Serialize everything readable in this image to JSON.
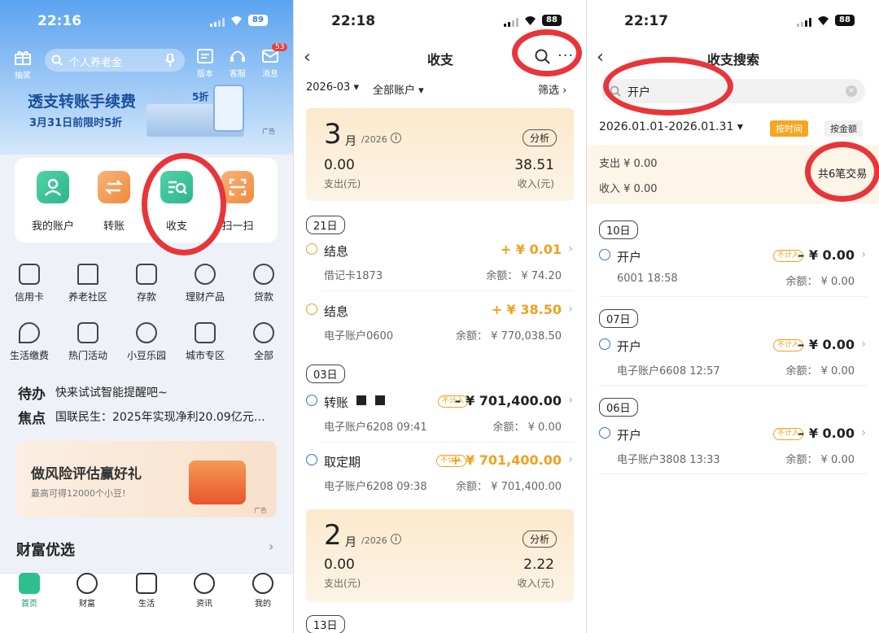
{
  "p1": {
    "time": "22:16",
    "battery": "89",
    "search_placeholder": "个人养老金",
    "top_icons": [
      "抽奖",
      "版本",
      "客服",
      "消息"
    ],
    "msg_badge": "53",
    "banner_title": "透支转账手续费",
    "banner_sub": "3月31日前限时5折",
    "banner_tag": "5折",
    "ad": "广告",
    "quick": [
      "我的账户",
      "转账",
      "收支",
      "扫一扫"
    ],
    "grid": [
      "信用卡",
      "养老社区",
      "存款",
      "理财产品",
      "贷款",
      "生活缴费",
      "热门活动",
      "小豆乐园",
      "城市专区",
      "全部"
    ],
    "todo_label": "待办",
    "todo_text": "快来试试智能提醒吧~",
    "focus_label": "焦点",
    "focus_text": "国联民生：2025年实现净利20.09亿元…",
    "promo_title": "做风险评估赢好礼",
    "promo_sub": "最高可得12000个小豆!",
    "wealth_title": "财富优选",
    "tabs": [
      "首页",
      "财富",
      "生活",
      "资讯",
      "我的"
    ],
    "colors": {
      "accent": "#1e6fd9",
      "green": "#2fbf8f",
      "orange": "#f5a04a"
    }
  },
  "p2": {
    "time": "22:18",
    "battery": "88",
    "title": "收支",
    "month_filter": "2026-03",
    "account_filter": "全部账户",
    "screen": "筛选",
    "cards": [
      {
        "month": "3",
        "unit": "月",
        "year": "/2026",
        "analyze": "分析",
        "expense": "0.00",
        "expense_label": "支出(元)",
        "income": "38.51",
        "income_label": "收入(元)"
      },
      {
        "month": "2",
        "unit": "月",
        "year": "/2026",
        "analyze": "分析",
        "expense": "0.00",
        "expense_label": "支出(元)",
        "income": "2.22",
        "income_label": "收入(元)"
      }
    ],
    "days": [
      "21日",
      "03日",
      "13日"
    ],
    "tx": [
      {
        "name": "结息",
        "amount": "+ ¥ 0.01",
        "acct": "借记卡1873",
        "bal": "余额： ¥  74.20"
      },
      {
        "name": "结息",
        "amount": "+ ¥ 38.50",
        "acct": "电子账户0600",
        "bal": "余额： ¥  770,038.50"
      },
      {
        "name": "转账",
        "tag": "不计入",
        "amount": "– ¥ 701,400.00",
        "acct": "电子账户6208 09:41",
        "bal": "余额： ¥  0.00"
      },
      {
        "name": "取定期",
        "tag": "不计入",
        "amount": "+ ¥ 701,400.00",
        "acct": "电子账户6208 09:38",
        "bal": "余额： ¥  701,400.00"
      }
    ]
  },
  "p3": {
    "time": "22:17",
    "battery": "88",
    "title": "收支搜索",
    "search_value": "开户",
    "date_range": "2026.01.01-2026.01.31",
    "sort_time": "按时间",
    "sort_amount": "按金额",
    "expense": "支出 ¥ 0.00",
    "income": "收入 ¥ 0.00",
    "count": "共6笔交易",
    "days": [
      "10日",
      "07日",
      "06日"
    ],
    "tx": [
      {
        "name": "开户",
        "tag": "不计入",
        "amount": "– ¥ 0.00",
        "acct": "6001 18:58",
        "bal": "余额： ¥  0.00"
      },
      {
        "name": "开户",
        "tag": "不计入",
        "amount": "– ¥ 0.00",
        "acct": "电子账户6608 12:57",
        "bal": "余额： ¥  0.00"
      },
      {
        "name": "开户",
        "tag": "不计入",
        "amount": "– ¥ 0.00",
        "acct": "电子账户3808 13:33",
        "bal": "余额： ¥  0.00"
      }
    ]
  }
}
